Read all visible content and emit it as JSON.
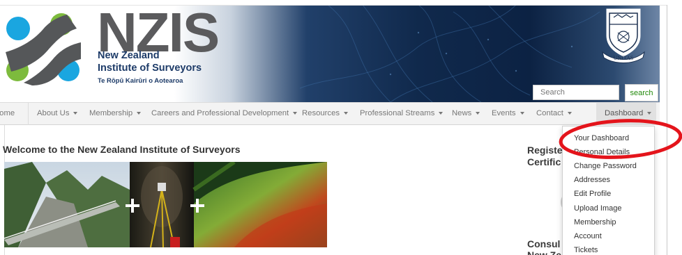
{
  "header": {
    "brand_letters": "NZIS",
    "brand_line1": "New Zealand",
    "brand_line2": "Institute of Surveyors",
    "brand_subtitle": "Te Rōpū Kairūri o Aotearoa",
    "crest_motto": "UNITAS",
    "search_placeholder": "Search",
    "search_button": "search"
  },
  "nav": {
    "items": [
      {
        "label": "Home",
        "has_caret": false
      },
      {
        "label": "About Us",
        "has_caret": true
      },
      {
        "label": "Membership",
        "has_caret": true
      },
      {
        "label": "Careers and Professional Development",
        "has_caret": true
      },
      {
        "label": "Resources",
        "has_caret": true
      },
      {
        "label": "Professional Streams",
        "has_caret": true
      },
      {
        "label": "News",
        "has_caret": true
      },
      {
        "label": "Events",
        "has_caret": true
      },
      {
        "label": "Contact",
        "has_caret": true
      },
      {
        "label": "Dashboard",
        "has_caret": true
      }
    ]
  },
  "main": {
    "welcome": "Welcome to the New Zealand Institute of Surveyors"
  },
  "sidebar": {
    "heading1_line1": "Registe",
    "heading1_line2": "Certific",
    "heading2_line1": "Consul",
    "heading2_line2": "New Ze"
  },
  "dashboard_menu": {
    "items": [
      "Your Dashboard",
      "Personal Details",
      "Change Password",
      "Addresses",
      "Edit Profile",
      "Upload Image",
      "Membership",
      "Account",
      "Tickets"
    ]
  },
  "colors": {
    "logo_green": "#7dbb3d",
    "logo_blue": "#1aa6e0",
    "logo_dark": "#555759",
    "brand_navy": "#1d3b68",
    "annotation_red": "#e4141b"
  }
}
